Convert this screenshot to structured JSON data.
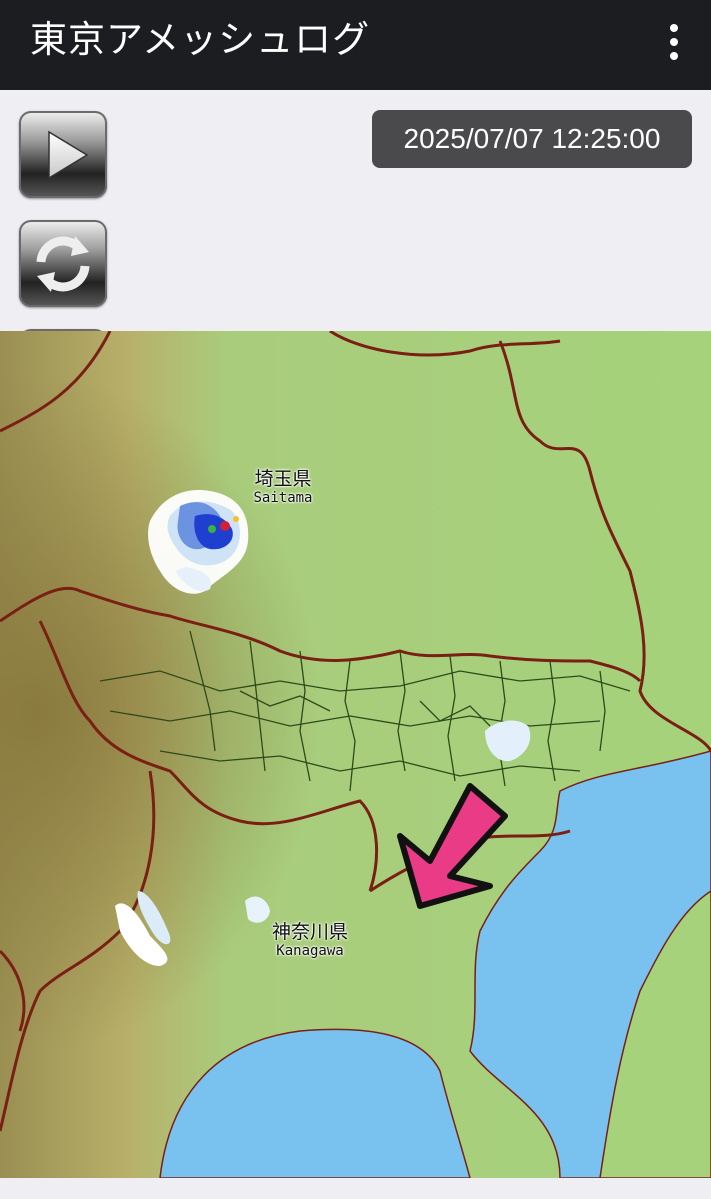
{
  "app": {
    "title": "東京アメッシュログ"
  },
  "appbar": {
    "menu_icon": "overflow-menu-icon"
  },
  "controls": {
    "play_icon": "play-icon",
    "refresh_icon": "refresh-icon",
    "comment_icon": "speech-bubble-icon"
  },
  "timestamp": "2025/07/07 12:25:00",
  "map": {
    "labels": {
      "saitama_jp": "埼玉県",
      "saitama_en": "Saitama",
      "kanagawa_jp": "神奈川県",
      "kanagawa_en": "Kanagawa"
    },
    "arrow_icon": "pink-arrow-icon",
    "colors": {
      "land": "#a9d27e",
      "mountain": "#a89a58",
      "sea": "#79c1ef",
      "prefecture_border": "#7a1f14",
      "ward_border": "#2e4a1a",
      "arrow": "#ea3c86"
    }
  }
}
